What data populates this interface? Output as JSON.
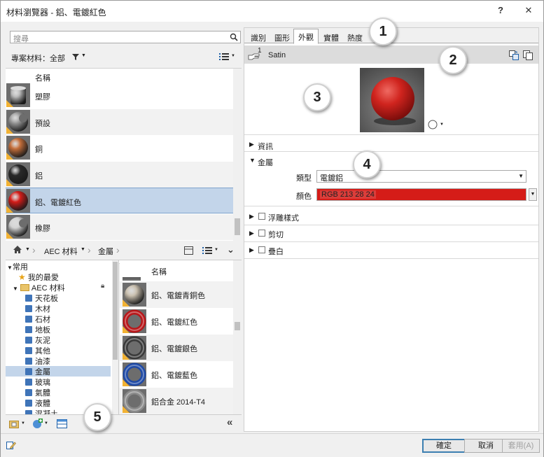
{
  "window": {
    "title": "材料瀏覽器 - 鋁、電鍍紅色",
    "help_label": "?",
    "close_label": "✕"
  },
  "left": {
    "search_placeholder": "搜尋",
    "project_filter": "專案材料：全部",
    "list_header": "名稱",
    "materials": [
      {
        "name": "塑膠",
        "swatch": "#b9b9b9",
        "shape": "cylinder"
      },
      {
        "name": "預設",
        "swatch": "#9a9a9a",
        "shape": "sphere-cut"
      },
      {
        "name": "銅",
        "swatch": "#c46e3a",
        "shape": "sphere"
      },
      {
        "name": "鋁",
        "swatch": "#2a2a2a",
        "shape": "sphere"
      },
      {
        "name": "鋁、電鍍紅色",
        "swatch": "#d51c18",
        "shape": "sphere"
      },
      {
        "name": "橡膠",
        "swatch": "#d2d2d2",
        "shape": "sphere-cut"
      }
    ],
    "breadcrumb": [
      "AEC 材料",
      "金屬"
    ],
    "tree": {
      "root": "常用",
      "favorites": "我的最愛",
      "library": "AEC 材料",
      "items": [
        "天花板",
        "木材",
        "石材",
        "地板",
        "灰泥",
        "其他",
        "油漆",
        "金屬",
        "玻璃",
        "氣體",
        "液體",
        "混凝土"
      ]
    },
    "lib_header": "名稱",
    "lib_items": [
      {
        "name": "鋁、電鍍青銅色",
        "swatch": "#c9bfae",
        "shape": "sphere"
      },
      {
        "name": "鋁、電鍍紅色",
        "swatch": "#b8171a",
        "shape": "ring"
      },
      {
        "name": "鋁、電鍍銀色",
        "swatch": "#3a3a3a",
        "shape": "ring"
      },
      {
        "name": "鋁、電鍍藍色",
        "swatch": "#1f4aa6",
        "shape": "ring"
      },
      {
        "name": "鋁合金 2014-T4",
        "swatch": "#8a8a8a",
        "shape": "ring"
      }
    ]
  },
  "right": {
    "tabs": [
      "識別",
      "圖形",
      "外觀",
      "實體",
      "熱度"
    ],
    "active_tab": "外觀",
    "asset_count": "1",
    "asset_name": "Satin",
    "sections": {
      "info": "資訊",
      "metal": "金屬",
      "relief": "浮雕樣式",
      "cutout": "剪切",
      "tint": "疊白"
    },
    "type_label": "類型",
    "type_value": "電鍍鋁",
    "color_label": "顏色",
    "color_value": "RGB 213 28 24",
    "color_hex": "#d51c18"
  },
  "footer": {
    "ok": "確定",
    "cancel": "取消",
    "apply": "套用(A)"
  },
  "callouts": [
    "1",
    "2",
    "3",
    "4",
    "5"
  ]
}
